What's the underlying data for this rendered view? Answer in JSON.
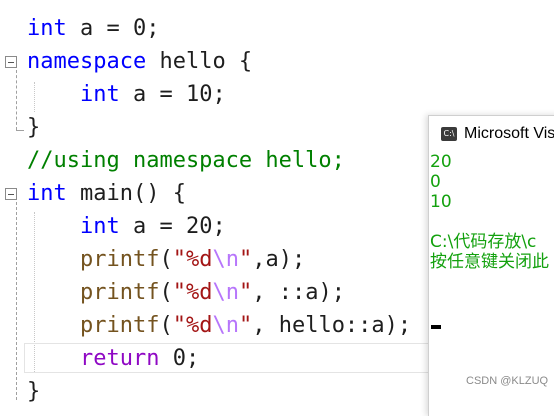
{
  "editor": {
    "lines": [
      {
        "parts": [
          {
            "t": "int",
            "c": "kw"
          },
          {
            "t": " a = 0;"
          }
        ]
      },
      {
        "parts": [
          {
            "t": "namespace",
            "c": "kw"
          },
          {
            "t": " hello {"
          }
        ]
      },
      {
        "parts": [
          {
            "t": "    "
          },
          {
            "t": "int",
            "c": "kw"
          },
          {
            "t": " a = 10;"
          }
        ]
      },
      {
        "parts": [
          {
            "t": "}"
          }
        ]
      },
      {
        "parts": [
          {
            "t": "//using namespace hello;",
            "c": "cm"
          }
        ]
      },
      {
        "parts": [
          {
            "t": "int",
            "c": "kw"
          },
          {
            "t": " main() {"
          }
        ]
      },
      {
        "parts": [
          {
            "t": "    "
          },
          {
            "t": "int",
            "c": "kw"
          },
          {
            "t": " a = 20;"
          }
        ]
      },
      {
        "parts": [
          {
            "t": "    "
          },
          {
            "t": "printf",
            "c": "fn"
          },
          {
            "t": "("
          },
          {
            "t": "\"%d",
            "c": "st"
          },
          {
            "t": "\\n",
            "c": "esc"
          },
          {
            "t": "\"",
            "c": "st"
          },
          {
            "t": ",a);"
          }
        ]
      },
      {
        "parts": [
          {
            "t": "    "
          },
          {
            "t": "printf",
            "c": "fn"
          },
          {
            "t": "("
          },
          {
            "t": "\"%d",
            "c": "st"
          },
          {
            "t": "\\n",
            "c": "esc"
          },
          {
            "t": "\"",
            "c": "st"
          },
          {
            "t": ", ::a);"
          }
        ]
      },
      {
        "parts": [
          {
            "t": "    "
          },
          {
            "t": "printf",
            "c": "fn"
          },
          {
            "t": "("
          },
          {
            "t": "\"%d",
            "c": "st"
          },
          {
            "t": "\\n",
            "c": "esc"
          },
          {
            "t": "\"",
            "c": "st"
          },
          {
            "t": ", hello::a);"
          }
        ]
      },
      {
        "parts": [
          {
            "t": "    "
          },
          {
            "t": "return",
            "c": "ret"
          },
          {
            "t": " 0;"
          }
        ]
      },
      {
        "parts": [
          {
            "t": "}"
          }
        ]
      }
    ]
  },
  "console": {
    "title": "Microsoft Vis",
    "icon_label": "C:\\",
    "output": [
      "20",
      "0",
      "10",
      "",
      "C:\\代码存放\\c",
      "按任意键关闭此"
    ]
  },
  "watermark": "CSDN @KLZUQ",
  "colors": {
    "keyword": "#0000ff",
    "comment": "#008000",
    "string": "#a31515",
    "function": "#74531f",
    "return_keyword": "#8f08c4",
    "console_text": "#13a10e"
  }
}
